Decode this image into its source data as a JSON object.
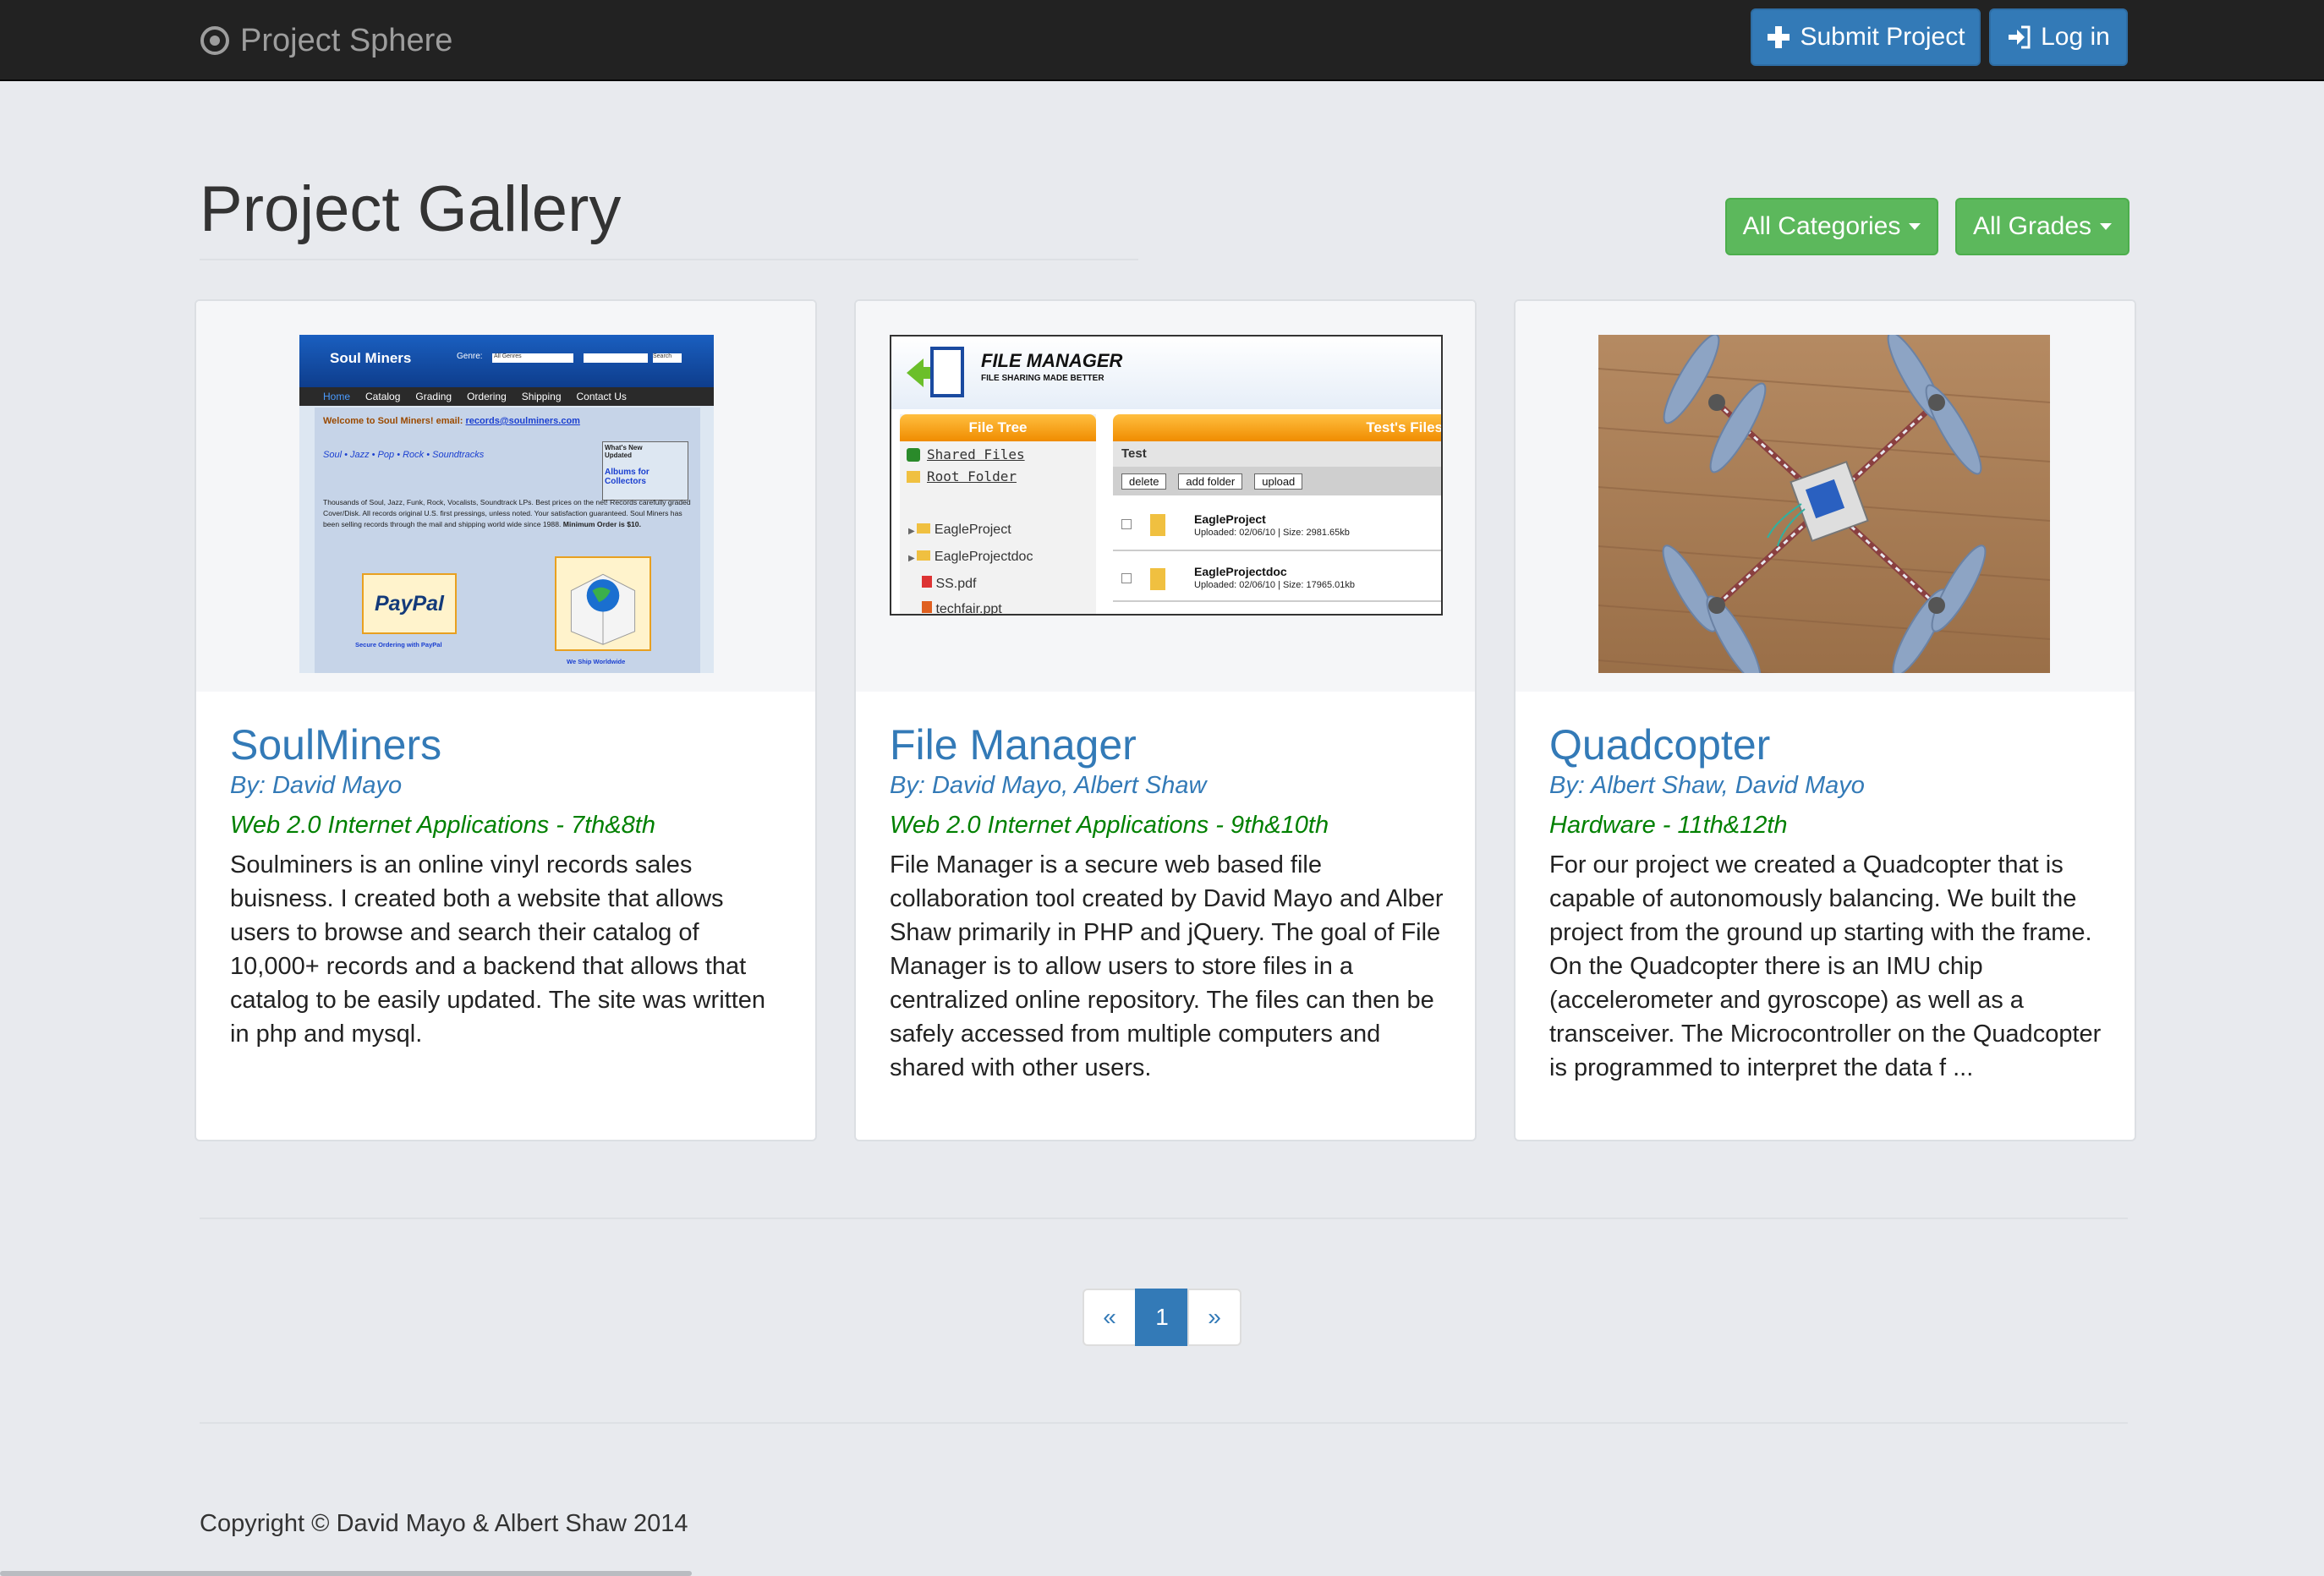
{
  "navbar": {
    "brand": "Project Sphere",
    "submit_label": "Submit Project",
    "login_label": "Log in"
  },
  "header": {
    "title": "Project Gallery",
    "categories_label": "All Categories",
    "grades_label": "All Grades"
  },
  "projects": [
    {
      "title": "SoulMiners",
      "authors": "By: David Mayo",
      "category": "Web 2.0 Internet Applications - 7th&8th",
      "description": "Soulminers is an online vinyl records sales buisness. I created both a website that allows users to browse and search their catalog of 10,000+ records and a backend that allows that catalog to be easily updated. The site was written in php and mysql.",
      "thumb": {
        "site_name": "Soul Miners",
        "genre_label": "Genre:",
        "genre_value": "All Genres",
        "search_btn": "Search",
        "nav": [
          "Home",
          "Catalog",
          "Grading",
          "Ordering",
          "Shipping",
          "Contact Us"
        ],
        "welcome": "Welcome to Soul Miners! email:",
        "email": "records@soulminers.com",
        "genres": "Soul • Jazz • Pop • Rock • Soundtracks",
        "whats_new": "What's New Updated",
        "albums": "Albums for Collectors",
        "body_text": "Thousands of Soul, Jazz, Funk, Rock, Vocalists, Soundtrack LPs. Best prices on the net! Records carefully graded Cover/Disk. All records original U.S. first pressings, unless noted. Your satisfaction guaranteed. Soul Miners has been selling records through the mail and shipping world wide since 1988.",
        "min_order": "Minimum Order is $10.",
        "paypal": "PayPal",
        "paypal_caption": "Secure Ordering with PayPal",
        "ship_caption": "We Ship Worldwide"
      }
    },
    {
      "title": "File Manager",
      "authors": "By: David Mayo, Albert Shaw",
      "category": "Web 2.0 Internet Applications - 9th&10th",
      "description": "File Manager is a secure web based file collaboration tool created by David Mayo and Alber Shaw primarily in PHP and jQuery. The goal of File Manager is to allow users to store files in a centralized online repository. The files can then be safely accessed from multiple computers and shared with other users.",
      "thumb": {
        "app_title": "FILE MANAGER",
        "tagline": "FILE SHARING MADE BETTER",
        "tree_header": "File Tree",
        "files_header": "Test's Files",
        "shared": "Shared Files",
        "root": "Root Folder",
        "tree_items": [
          "EagleProject",
          "EagleProjectdoc",
          "SS.pdf",
          "techfair.ppt"
        ],
        "folder_name": "Test",
        "btn_delete": "delete",
        "btn_add": "add folder",
        "btn_upload": "upload",
        "rows": [
          {
            "name": "EagleProject",
            "meta": "Uploaded: 02/06/10 | Size: 2981.65kb"
          },
          {
            "name": "EagleProjectdoc",
            "meta": "Uploaded: 02/06/10 | Size: 17965.01kb"
          }
        ]
      }
    },
    {
      "title": "Quadcopter",
      "authors": "By: Albert Shaw, David Mayo",
      "category": "Hardware - 11th&12th",
      "description": "For our project we created a Quadcopter that is capable of autonomously balancing. We built the project from the ground up starting with the frame. On the Quadcopter there is an IMU chip (accelerometer and gyroscope) as well as a transceiver. The Microcontroller on the Quadcopter is programmed to interpret the data f ..."
    }
  ],
  "pagination": {
    "prev": "«",
    "current": "1",
    "next": "»"
  },
  "footer": {
    "copyright": "Copyright © David Mayo & Albert Shaw 2014"
  },
  "colors": {
    "navbar": "#222222",
    "primary": "#337ab7",
    "success": "#5cb85c",
    "category_text": "#008000",
    "background": "#e8eaee"
  }
}
